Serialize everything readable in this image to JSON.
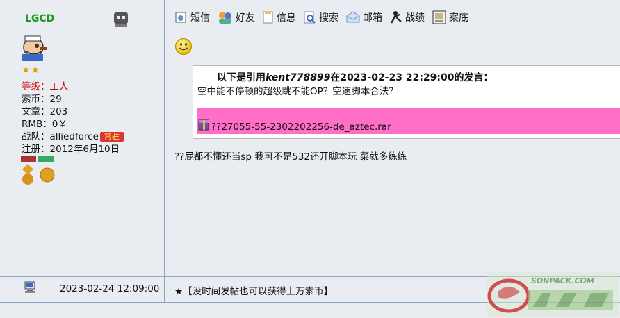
{
  "user": {
    "name": "LGCD",
    "stars": "★★",
    "level_label": "等级：",
    "level_value": "工人",
    "coins": "索币：29",
    "posts": "文章：203",
    "rmb": "RMB：0￥",
    "team_label": "战队：alliedforce",
    "team_badge": "常驻",
    "registered": "注册：2012年6月10日"
  },
  "toolbar": {
    "items": [
      {
        "label": "短信",
        "icon": "message-icon"
      },
      {
        "label": "好友",
        "icon": "friends-icon"
      },
      {
        "label": "信息",
        "icon": "info-icon"
      },
      {
        "label": "搜索",
        "icon": "search-icon"
      },
      {
        "label": "邮箱",
        "icon": "mail-icon"
      },
      {
        "label": "战绩",
        "icon": "record-icon"
      },
      {
        "label": "案底",
        "icon": "case-icon"
      }
    ]
  },
  "quote": {
    "prefix": "以下是引用",
    "author": "kent778899",
    "suffix": "在2023-02-23 22:29:00的发言：",
    "body": "空中能不停顿的超级跳不能OP？空速脚本合法？",
    "attachment": "??27055-55-2302202256-de_aztec.rar"
  },
  "post": {
    "reply": "??屁都不懂还当sp 我可不是532还开脚本玩 菜就多练练"
  },
  "footer": {
    "date": "2023-02-24 12:09:00",
    "signature": "★【没时间发帖也可以获得上万索币】",
    "watermark_text": "SONPACK.COM"
  },
  "colors": {
    "background": "#e9edf2",
    "divider": "#8aa6c8",
    "username": "#1b9a1b",
    "attachment_bg": "#ff6ec7",
    "level": "#cc0000"
  }
}
